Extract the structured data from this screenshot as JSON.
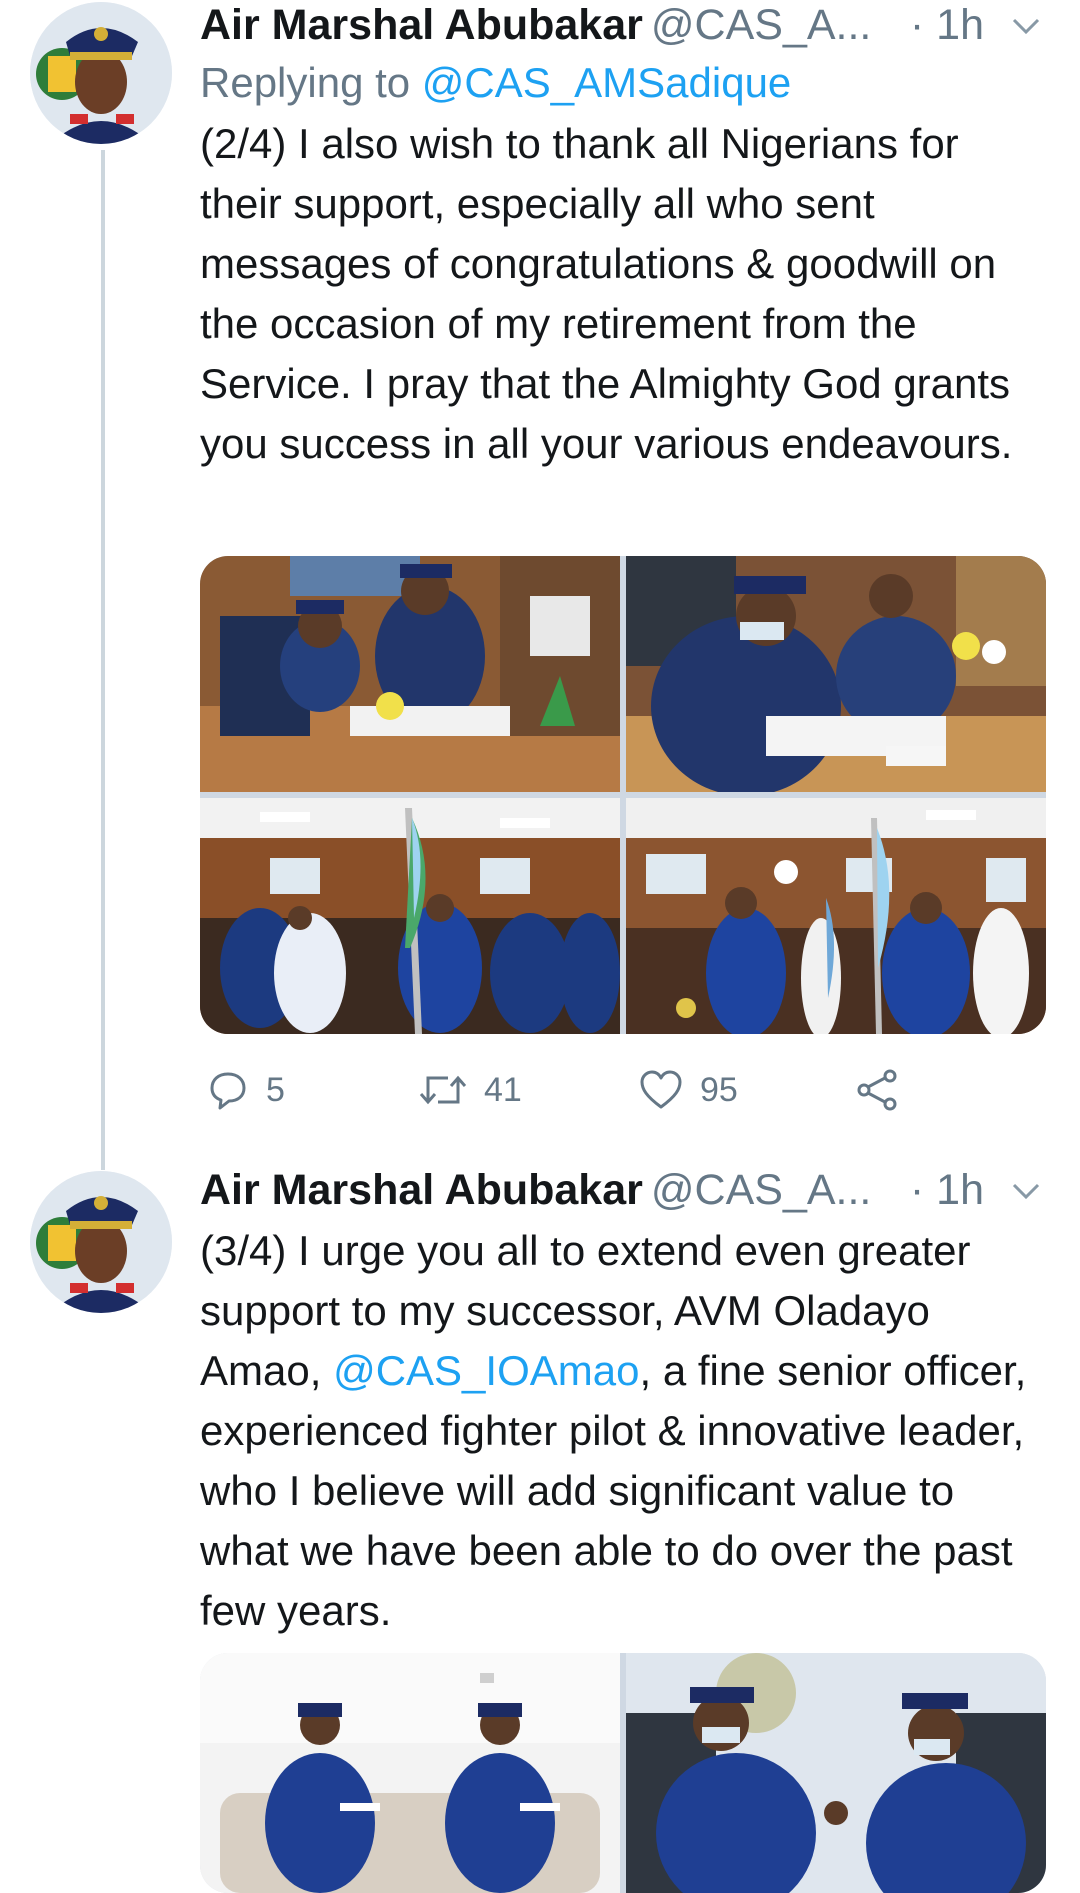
{
  "tweets": [
    {
      "author": {
        "name": "Air Marshal Abubakar",
        "handle": "@CAS_A...",
        "avatar_icon": "officer-portrait-avatar"
      },
      "time": "· 1h",
      "reply_prefix": "Replying to ",
      "reply_mention": "@CAS_AMSadique",
      "text": "(2/4) I also wish to thank all Nigerians for their support, especially all who sent messages of congratulations & goodwill on the occasion of my retirement from the Service. I pray that the Almighty God grants you success in all your various endeavours.",
      "photos": [
        "signing-ceremony-photo-1",
        "signing-ceremony-photo-2",
        "flag-handover-photo-1",
        "flag-handover-photo-2"
      ],
      "actions": {
        "replies": "5",
        "retweets": "41",
        "likes": "95",
        "icons": [
          "reply-icon",
          "retweet-icon",
          "like-icon",
          "share-icon"
        ]
      }
    },
    {
      "author": {
        "name": "Air Marshal Abubakar",
        "handle": "@CAS_A...",
        "avatar_icon": "officer-portrait-avatar"
      },
      "time": "· 1h",
      "text_before": "(3/4) I urge you all to extend even greater support to my successor, AVM Oladayo Amao, ",
      "text_mention": "@CAS_IOAmao",
      "text_after": ", a fine senior officer, experienced fighter pilot & innovative leader, who I believe will add significant value to what we have been able to do over the past few years.",
      "photos": [
        "officers-seated-photo",
        "officers-meeting-photo"
      ]
    }
  ],
  "colors": {
    "link": "#1da1f2",
    "secondary": "#657786",
    "thread_line": "#ccd6dd",
    "text": "#14171a"
  }
}
